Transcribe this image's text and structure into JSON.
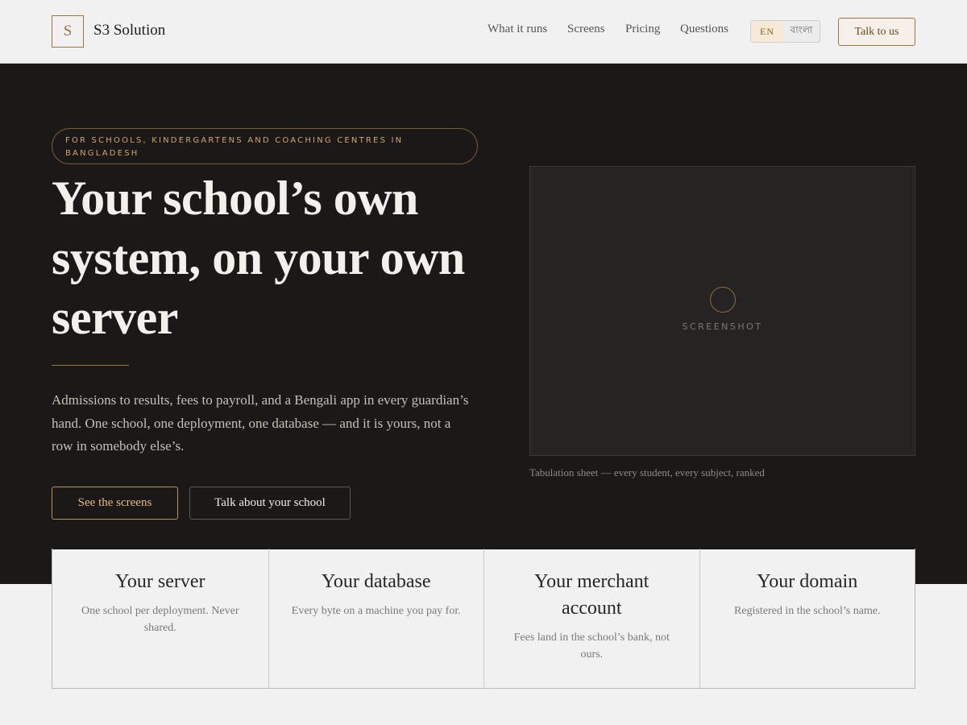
{
  "header": {
    "logo_letter": "S",
    "brand": "S3 Solution",
    "nav": [
      "What it runs",
      "Screens",
      "Pricing",
      "Questions"
    ],
    "lang": {
      "en": "EN",
      "bn": "বাংলা"
    },
    "cta": "Talk to us"
  },
  "hero": {
    "eyebrow": "For schools, kindergartens and coaching centres in Bangladesh",
    "headline": "Your school’s own system, on your own server",
    "lead": "Admissions to results, fees to payroll, and a Bengali app in every guardian’s hand. One school, one deployment, one database — and it is yours, not a row in somebody else’s.",
    "primary_cta": "See the screens",
    "secondary_cta": "Talk about your school",
    "screenshot_label": "SCREENSHOT",
    "screenshot_caption": "Tabulation sheet — every student, every subject, ranked"
  },
  "features": [
    {
      "title": "Your server",
      "text": "One school per deployment. Never shared."
    },
    {
      "title": "Your database",
      "text": "Every byte on a machine you pay for."
    },
    {
      "title": "Your merchant account",
      "text": "Fees land in the school’s bank, not ours."
    },
    {
      "title": "Your domain",
      "text": "Registered in the school’s name."
    }
  ],
  "colors": {
    "accent": "#a0743a",
    "hero_bg": "#1b1918",
    "page_bg": "#f1f1f1"
  }
}
